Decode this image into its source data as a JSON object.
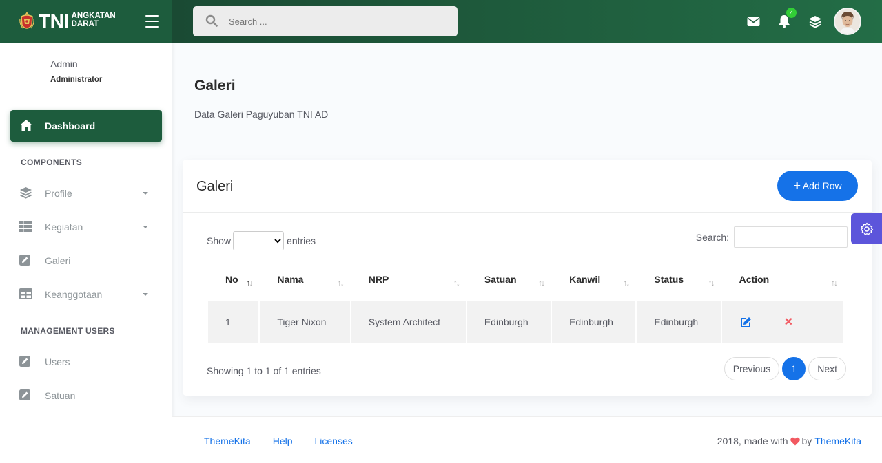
{
  "brand": {
    "main": "TNI",
    "sub_line1": "ANGKATAN",
    "sub_line2": "DARAT"
  },
  "topbar": {
    "search_placeholder": "Search ...",
    "notification_count": "4",
    "icons": [
      "envelope-icon",
      "bell-icon",
      "layers-icon"
    ]
  },
  "sidebar": {
    "user": {
      "name": "Admin",
      "role": "Administrator"
    },
    "dashboard_label": "Dashboard",
    "section_components": "COMPONENTS",
    "components": [
      {
        "label": "Profile",
        "icon": "layers-icon",
        "has_caret": true
      },
      {
        "label": "Kegiatan",
        "icon": "list-icon",
        "has_caret": true
      },
      {
        "label": "Galeri",
        "icon": "edit-icon",
        "has_caret": false
      },
      {
        "label": "Keanggotaan",
        "icon": "grid-icon",
        "has_caret": true
      }
    ],
    "section_management": "MANAGEMENT USERS",
    "management": [
      {
        "label": "Users",
        "icon": "edit-icon"
      },
      {
        "label": "Satuan",
        "icon": "edit-icon"
      }
    ]
  },
  "page": {
    "title": "Galeri",
    "subtitle": "Data Galeri Paguyuban TNI AD"
  },
  "card": {
    "title": "Galeri",
    "add_button": "Add Row",
    "show_label": "Show",
    "entries_label": "entries",
    "search_label": "Search:",
    "columns": [
      "No",
      "Nama",
      "NRP",
      "Satuan",
      "Kanwil",
      "Status",
      "Action"
    ],
    "rows": [
      {
        "no": "1",
        "nama": "Tiger Nixon",
        "nrp": "System Architect",
        "satuan": "Edinburgh",
        "kanwil": "Edinburgh",
        "status": "Edinburgh"
      }
    ],
    "info": "Showing 1 to 1 of 1 entries",
    "pagination": {
      "previous": "Previous",
      "current": "1",
      "next": "Next"
    }
  },
  "footer": {
    "links": [
      "ThemeKita",
      "Help",
      "Licenses"
    ],
    "copy_prefix": "2018, made with",
    "copy_by": "by",
    "copy_link": "ThemeKita"
  },
  "colors": {
    "primary_green": "#1d5c3d",
    "accent_blue": "#1572e8",
    "danger": "#f25961",
    "settings": "#5c55db",
    "badge": "#31ce36"
  }
}
